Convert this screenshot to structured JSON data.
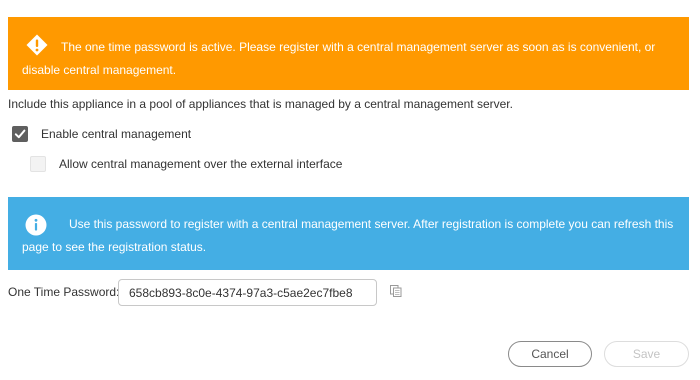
{
  "warning_banner": {
    "icon": "warning-diamond-icon",
    "text": "The one time password is active.  Please register with a central management server as soon as is convenient, or disable central management.",
    "color": "#ff9900"
  },
  "description": "Include this appliance in a pool of appliances that is managed by a central management server.",
  "checkboxes": {
    "enable_central_management": {
      "label": "Enable central management",
      "checked": true
    },
    "allow_external_interface": {
      "label": "Allow central management over the external interface",
      "checked": false
    }
  },
  "info_banner": {
    "icon": "info-icon",
    "text": "Use this password to register with a central management server.  After registration is complete you can refresh this page to see the registration status.",
    "color": "#44aee4"
  },
  "otp": {
    "label": "One Time Password:",
    "value": "658cb893-8c0e-4374-97a3-c5ae2ec7fbe8",
    "copy_icon": "copy-icon"
  },
  "buttons": {
    "cancel_label": "Cancel",
    "save_label": "Save"
  }
}
